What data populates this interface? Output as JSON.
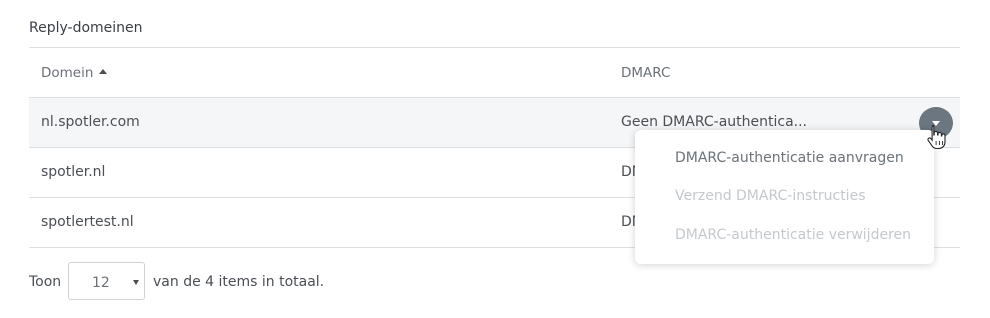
{
  "section": {
    "title": "Reply-domeinen"
  },
  "table": {
    "columns": {
      "domain": "Domein",
      "dmarc": "DMARC"
    },
    "rows": [
      {
        "domain": "nl.spotler.com",
        "dmarc": "Geen DMARC-authentica..."
      },
      {
        "domain": "spotler.nl",
        "dmarc": "DM"
      },
      {
        "domain": "spotlertest.nl",
        "dmarc": "DM"
      }
    ]
  },
  "dropdown": {
    "items": [
      {
        "label": "DMARC-authenticatie aanvragen",
        "enabled": true
      },
      {
        "label": "Verzend DMARC-instructies",
        "enabled": false
      },
      {
        "label": "DMARC-authenticatie verwijderen",
        "enabled": false
      }
    ]
  },
  "pagination": {
    "show_label": "Toon",
    "page_size": "12",
    "total_label": "van de 4 items in totaal."
  },
  "colors": {
    "action_button": "#6b7680",
    "row_hover": "#f5f6f7",
    "disabled_text": "#c4c8cc"
  }
}
